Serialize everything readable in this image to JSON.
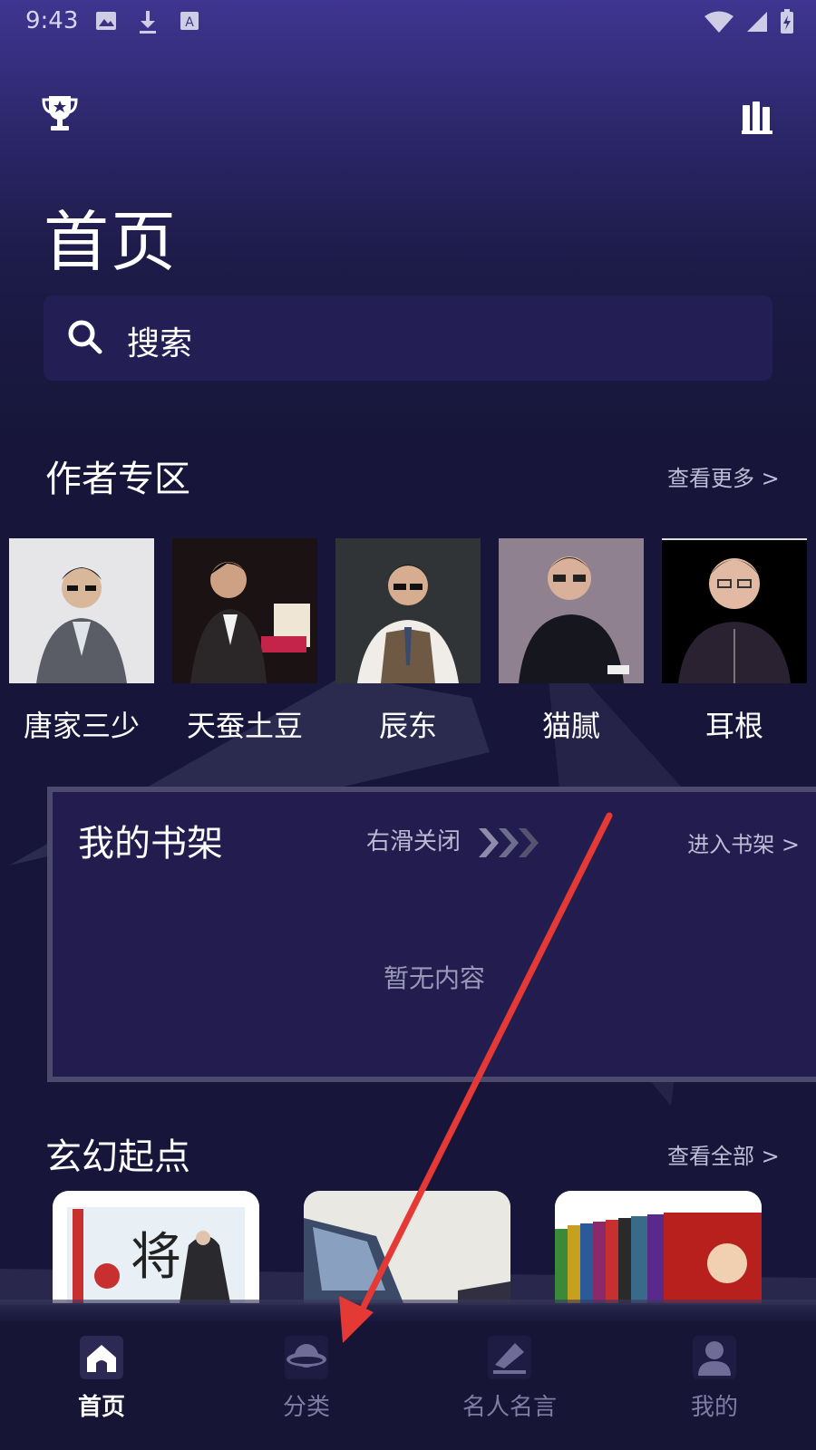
{
  "status_bar": {
    "time": "9:43"
  },
  "header": {
    "title": "首页",
    "left_icon": "trophy-icon",
    "right_icon": "bookshelf-icon"
  },
  "search": {
    "placeholder": "搜索"
  },
  "authors_section": {
    "title": "作者专区",
    "more_label": "查看更多 >",
    "authors": [
      {
        "name": "唐家三少"
      },
      {
        "name": "天蚕土豆"
      },
      {
        "name": "辰东"
      },
      {
        "name": "猫腻"
      },
      {
        "name": "耳根"
      }
    ]
  },
  "bookshelf": {
    "title": "我的书架",
    "swipe_hint": "右滑关闭",
    "enter_label": "进入书架 >",
    "empty_text": "暂无内容"
  },
  "xuanhuan_section": {
    "title": "玄幻起点",
    "all_label": "查看全部 >"
  },
  "tabbar": {
    "tabs": [
      {
        "label": "首页",
        "icon": "home-icon",
        "active": true
      },
      {
        "label": "分类",
        "icon": "planet-icon",
        "active": false
      },
      {
        "label": "名人名言",
        "icon": "quill-icon",
        "active": false
      },
      {
        "label": "我的",
        "icon": "person-icon",
        "active": false
      }
    ]
  },
  "colors": {
    "accent": "#3f3590",
    "background": "#17163a",
    "annotation_arrow": "#e53935"
  }
}
